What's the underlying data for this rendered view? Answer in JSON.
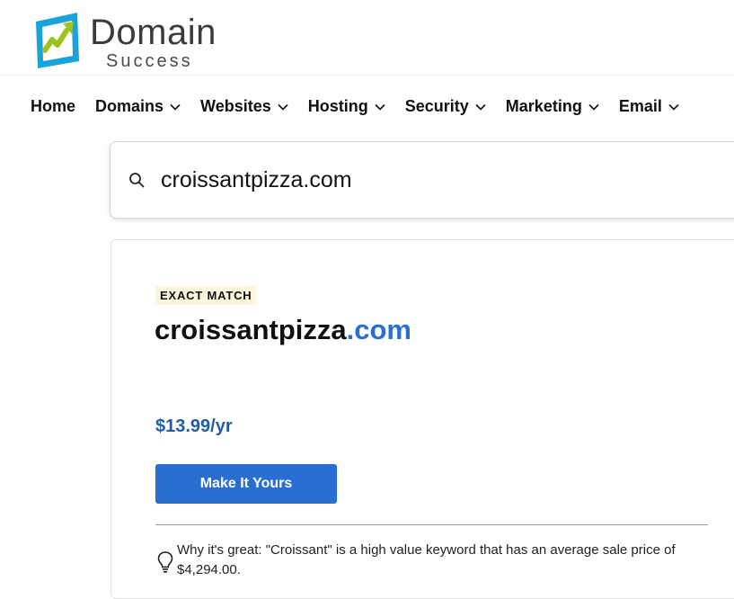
{
  "brand": {
    "name_line1": "Domain",
    "name_line2": "Success",
    "colors": {
      "mark_frame": "#1aa3d9",
      "mark_arrow": "#9bc31c",
      "wordmark": "#3b3b3b"
    }
  },
  "nav": {
    "items": [
      {
        "label": "Home",
        "has_dropdown": false
      },
      {
        "label": "Domains",
        "has_dropdown": true
      },
      {
        "label": "Websites",
        "has_dropdown": true
      },
      {
        "label": "Hosting",
        "has_dropdown": true
      },
      {
        "label": "Security",
        "has_dropdown": true
      },
      {
        "label": "Marketing",
        "has_dropdown": true
      },
      {
        "label": "Email",
        "has_dropdown": true
      }
    ]
  },
  "search": {
    "value": "croissantpizza.com",
    "icon": "search-icon"
  },
  "result": {
    "badge": "EXACT MATCH",
    "domain_sld": "croissantpizza",
    "domain_tld": ".com",
    "price": "$13.99/yr",
    "cta_label": "Make It Yours",
    "tip_icon": "lightbulb-icon",
    "tip_text": "Why it's great: \"Croissant\" is a high value keyword that has an average sale price of $4,294.00.",
    "colors": {
      "accent": "#2a6ed1",
      "price": "#1f5da8",
      "badge_bg": "#fdf5dc"
    }
  }
}
